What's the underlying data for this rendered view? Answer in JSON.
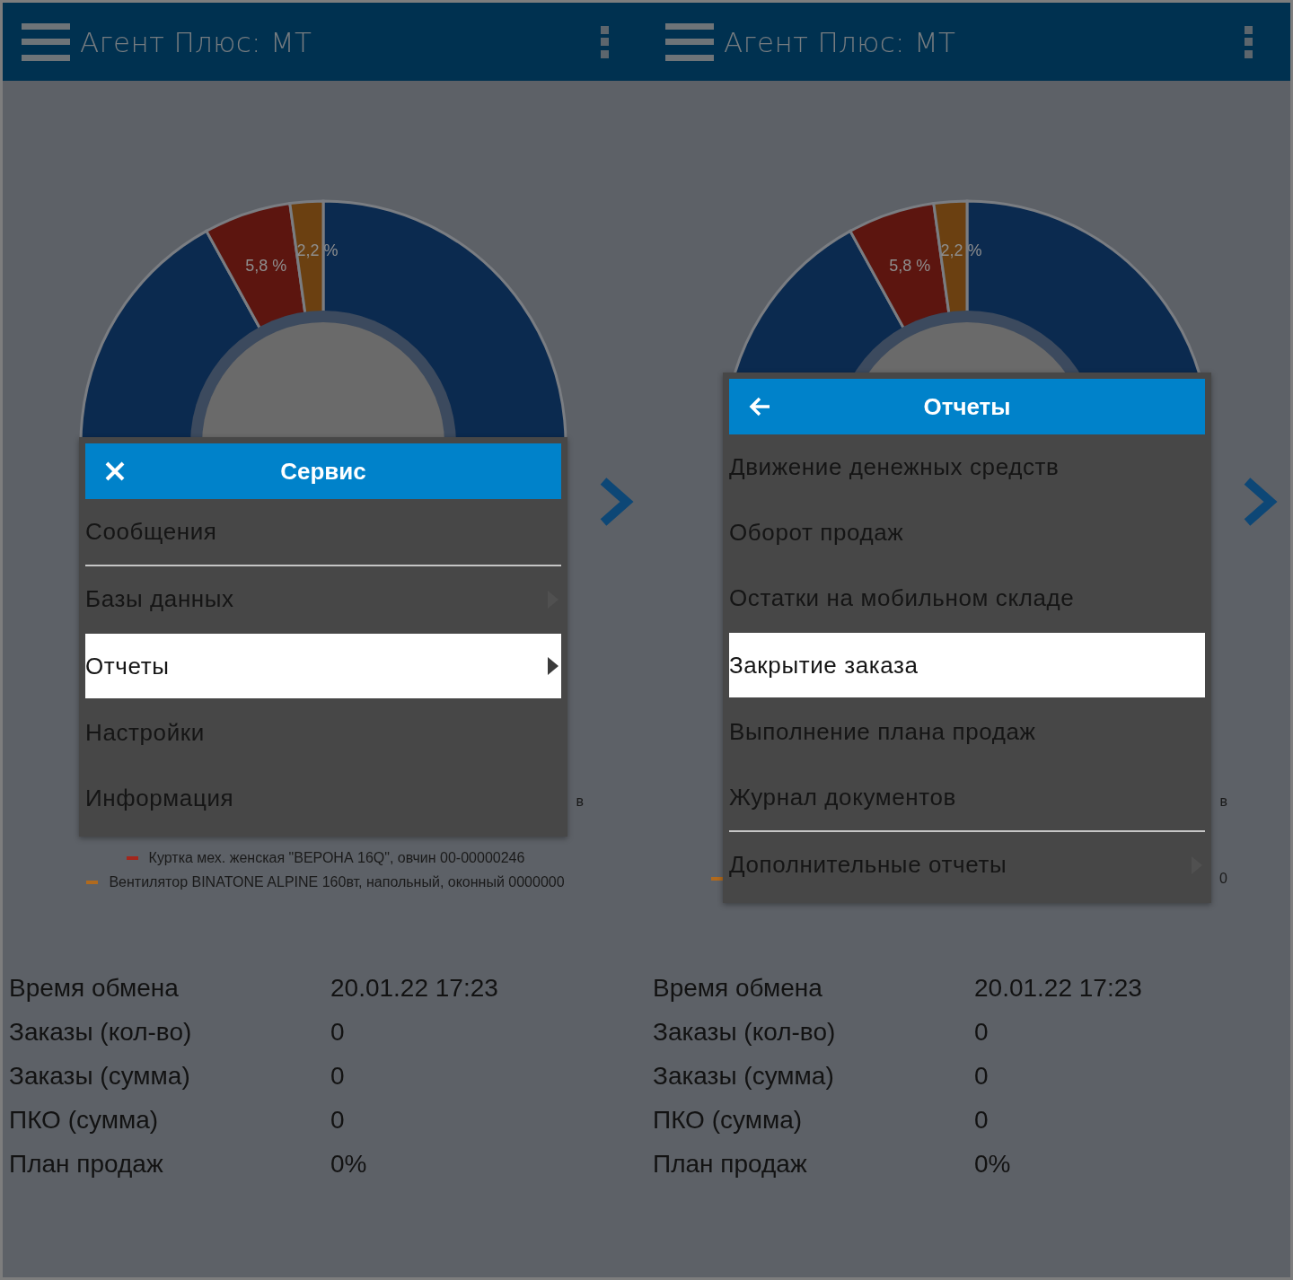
{
  "screens": [
    {
      "app_bar": {
        "title": "Агент Плюс: МТ"
      },
      "chart": {
        "chart_data": {
          "type": "donut",
          "values": [
            92,
            5.8,
            2.2
          ],
          "colors": [
            "#0b2a4f",
            "#5c150f",
            "#6b4011"
          ],
          "value_labels": [
            null,
            "5,8 %",
            "2,2 %"
          ]
        }
      },
      "legend": [
        {
          "kind": "tail",
          "text": "в"
        },
        {
          "kind": "whole",
          "color": "#a3261c",
          "text": "Куртка мех. женская \"ВЕРОНА 16Q\", овчин 00-00000246"
        },
        {
          "kind": "whole",
          "color": "#b06a1e",
          "text": "Вентилятор BINATONE ALPINE 160вт, напольный, оконный 0000000"
        }
      ],
      "dialog": {
        "kind": "main",
        "title": "Сервис",
        "items": [
          {
            "label": "Сообщения",
            "selected": false,
            "submenu": false,
            "divider_after": true
          },
          {
            "label": "Базы данных",
            "selected": false,
            "submenu": true,
            "divider_after": false
          },
          {
            "label": "Отчеты",
            "selected": true,
            "submenu": true,
            "divider_after": false
          },
          {
            "label": "Настройки",
            "selected": false,
            "submenu": false,
            "divider_after": false
          },
          {
            "label": "Информация",
            "selected": false,
            "submenu": false,
            "divider_after": false
          }
        ]
      },
      "stats": [
        {
          "label": "Время обмена",
          "value": "20.01.22 17:23"
        },
        {
          "label": "Заказы (кол-во)",
          "value": "0"
        },
        {
          "label": "Заказы (сумма)",
          "value": "0"
        },
        {
          "label": "ПКО (сумма)",
          "value": "0"
        },
        {
          "label": "План продаж",
          "value": "0%"
        }
      ]
    },
    {
      "app_bar": {
        "title": "Агент Плюс: МТ"
      },
      "chart": {
        "chart_data": {
          "type": "donut",
          "values": [
            92,
            5.8,
            2.2
          ],
          "colors": [
            "#0b2a4f",
            "#5c150f",
            "#6b4011"
          ],
          "value_labels": [
            null,
            "5,8 %",
            "2,2 %"
          ]
        }
      },
      "legend": [
        {
          "kind": "tail",
          "text": "в"
        },
        {
          "kind": "tail",
          "color": "#b06a1e",
          "text": "0"
        }
      ],
      "dialog": {
        "kind": "submenu",
        "title": "Отчеты",
        "items": [
          {
            "label": "Движение денежных средств",
            "selected": false,
            "submenu": false,
            "divider_after": false
          },
          {
            "label": "Оборот продаж",
            "selected": false,
            "submenu": false,
            "divider_after": false
          },
          {
            "label": "Остатки на мобильном складе",
            "selected": false,
            "submenu": false,
            "divider_after": false
          },
          {
            "label": "Закрытие заказа",
            "selected": true,
            "submenu": false,
            "divider_after": false
          },
          {
            "label": "Выполнение плана продаж",
            "selected": false,
            "submenu": false,
            "divider_after": false
          },
          {
            "label": "Журнал документов",
            "selected": false,
            "submenu": false,
            "divider_after": true
          },
          {
            "label": "Дополнительные отчеты",
            "selected": false,
            "submenu": true,
            "divider_after": false
          }
        ]
      },
      "stats": [
        {
          "label": "Время обмена",
          "value": "20.01.22 17:23"
        },
        {
          "label": "Заказы (кол-во)",
          "value": "0"
        },
        {
          "label": "Заказы (сумма)",
          "value": "0"
        },
        {
          "label": "ПКО (сумма)",
          "value": "0"
        },
        {
          "label": "План продаж",
          "value": "0%"
        }
      ]
    }
  ]
}
